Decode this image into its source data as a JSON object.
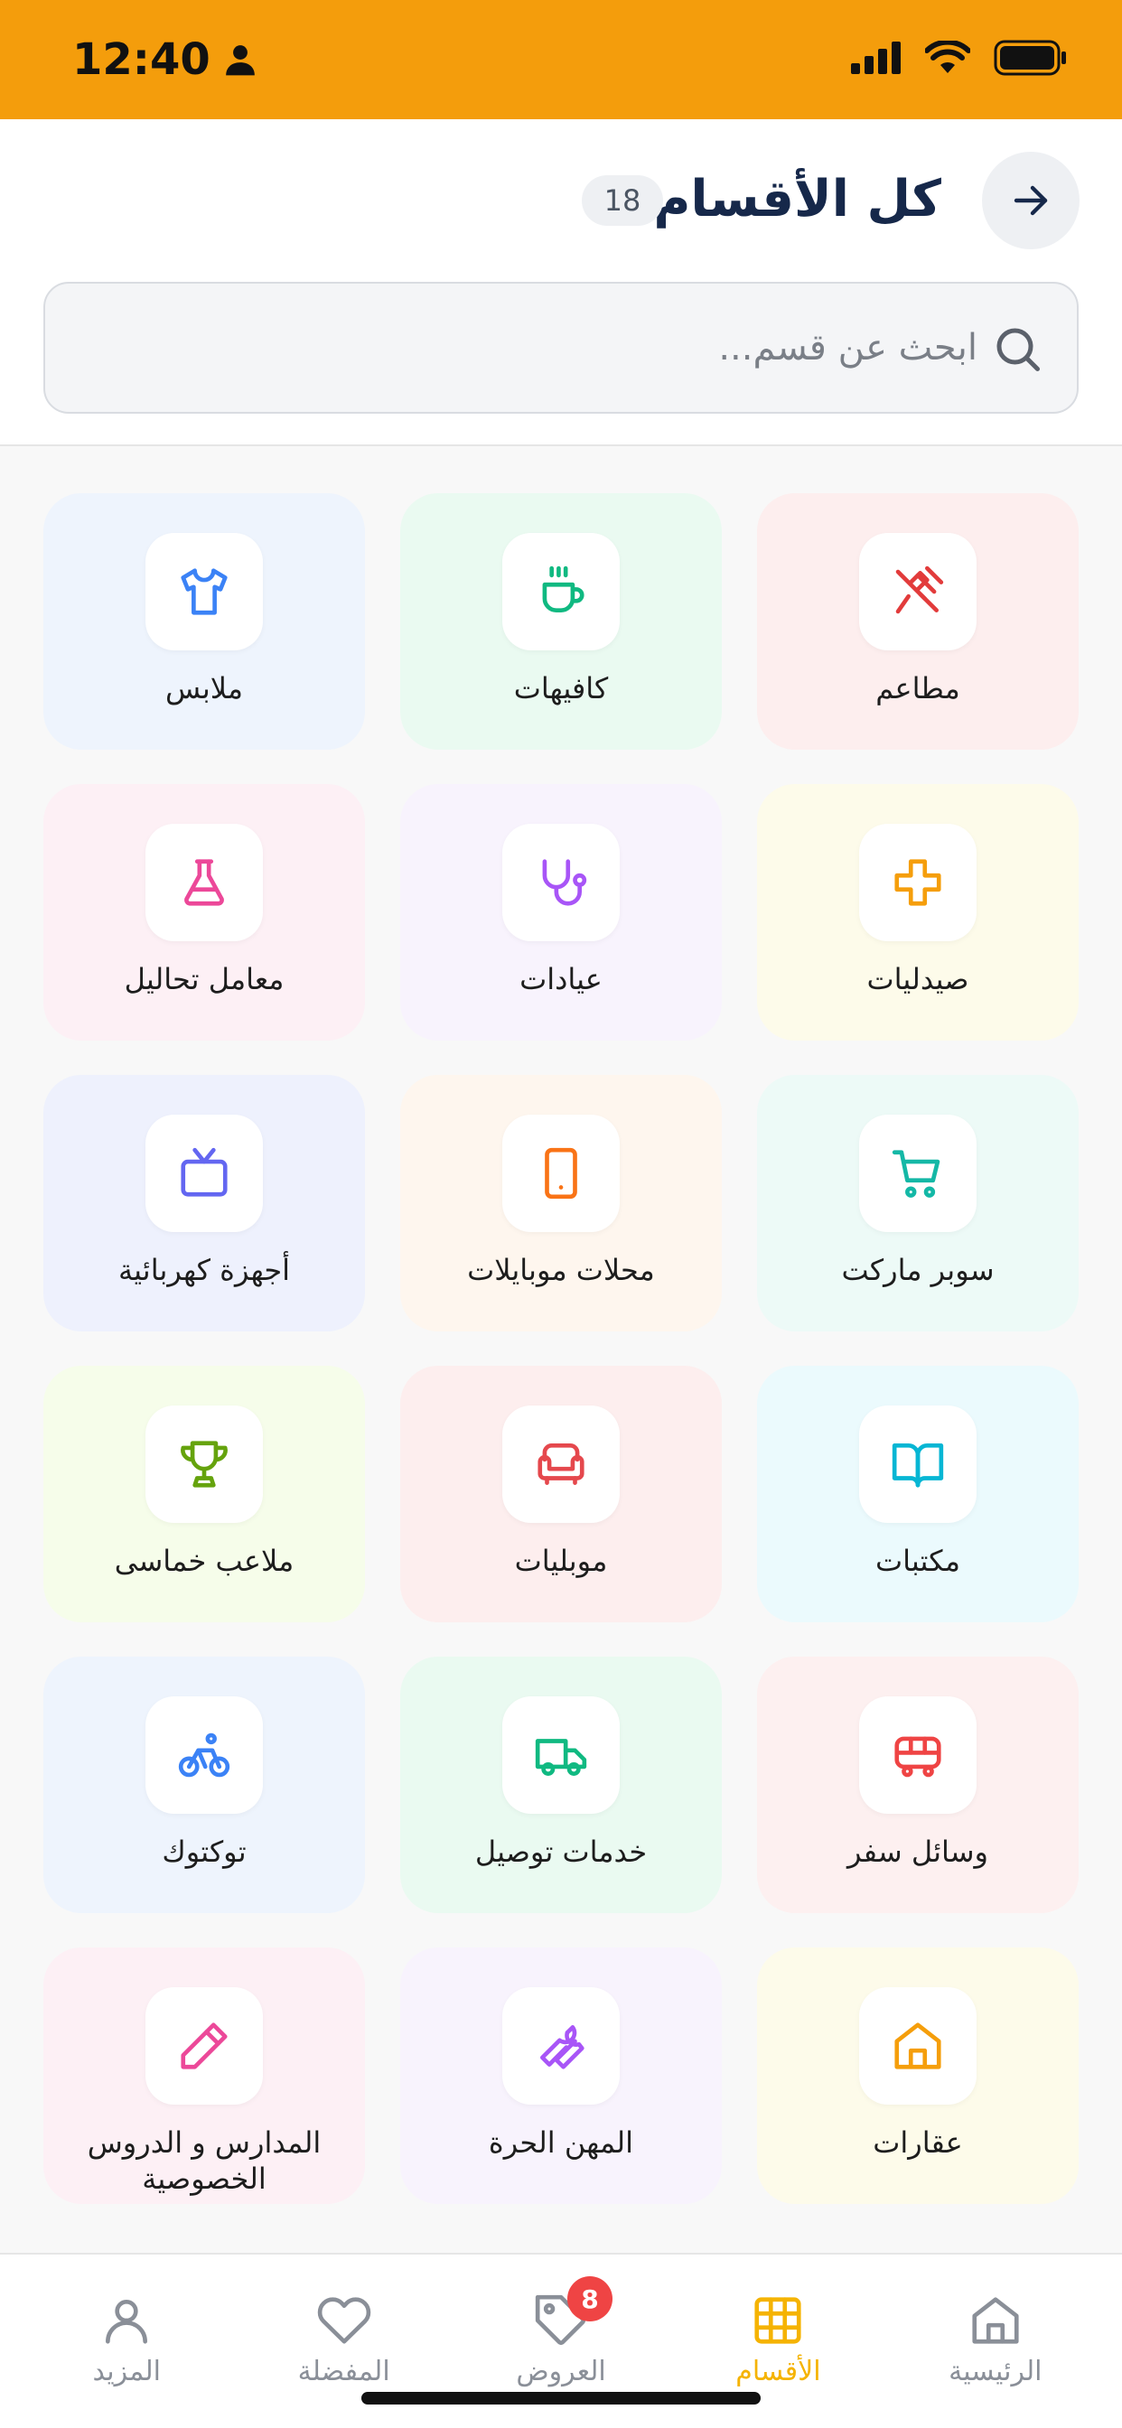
{
  "status_bar": {
    "time": "12:40"
  },
  "header": {
    "title": "كل الأقسام",
    "count": "18"
  },
  "search": {
    "placeholder": "ابحث عن قسم..."
  },
  "categories": [
    {
      "label": "مطاعم",
      "icon": "utensils-crossed-icon",
      "color": "#e23b3b",
      "bg": "#fdeeee"
    },
    {
      "label": "كافيهات",
      "icon": "coffee-cup-icon",
      "color": "#10b981",
      "bg": "#eafaf1"
    },
    {
      "label": "ملابس",
      "icon": "shirt-icon",
      "color": "#3b82f6",
      "bg": "#eef4fd"
    },
    {
      "label": "صيدليات",
      "icon": "medical-cross-icon",
      "color": "#f59e0b",
      "bg": "#fdfbea"
    },
    {
      "label": "عيادات",
      "icon": "stethoscope-icon",
      "color": "#a855f7",
      "bg": "#f8f3fd"
    },
    {
      "label": "معامل تحاليل",
      "icon": "flask-icon",
      "color": "#ec4899",
      "bg": "#fdf0f5"
    },
    {
      "label": "سوبر ماركت",
      "icon": "shopping-cart-icon",
      "color": "#14b8a6",
      "bg": "#edfaf7"
    },
    {
      "label": "محلات موبايلات",
      "icon": "smartphone-icon",
      "color": "#f97316",
      "bg": "#fef6ee"
    },
    {
      "label": "أجهزة كهربائية",
      "icon": "tv-icon",
      "color": "#6366f1",
      "bg": "#eef1fd"
    },
    {
      "label": "مكتبات",
      "icon": "book-open-icon",
      "color": "#06b6d4",
      "bg": "#ebfafd"
    },
    {
      "label": "موبليات",
      "icon": "sofa-icon",
      "color": "#e5484d",
      "bg": "#fdeeee"
    },
    {
      "label": "ملاعب خماسى",
      "icon": "trophy-icon",
      "color": "#65a30d",
      "bg": "#f6fdea"
    },
    {
      "label": "وسائل سفر",
      "icon": "bus-icon",
      "color": "#ef4444",
      "bg": "#fdf0f0"
    },
    {
      "label": "خدمات توصيل",
      "icon": "truck-icon",
      "color": "#10b981",
      "bg": "#eafaf1"
    },
    {
      "label": "توكتوك",
      "icon": "bicycle-icon",
      "color": "#3b82f6",
      "bg": "#eef4fd"
    },
    {
      "label": "عقارات",
      "icon": "house-icon",
      "color": "#f59e0b",
      "bg": "#fdfbea"
    },
    {
      "label": "المهن الحرة",
      "icon": "wrench-icon",
      "color": "#a855f7",
      "bg": "#f8f3fd"
    },
    {
      "label": "المدارس و الدروس الخصوصية",
      "icon": "pencil-icon",
      "color": "#ec4899",
      "bg": "#fdf0f5"
    }
  ],
  "bottom_nav": [
    {
      "label": "الرئيسية",
      "icon": "home-icon",
      "active": false
    },
    {
      "label": "الأقسام",
      "icon": "grid-icon",
      "active": true
    },
    {
      "label": "العروض",
      "icon": "tag-icon",
      "active": false,
      "badge": "8"
    },
    {
      "label": "المفضلة",
      "icon": "heart-icon",
      "active": false
    },
    {
      "label": "المزيد",
      "icon": "user-icon",
      "active": false
    }
  ],
  "colors": {
    "accent": "#f49d0c",
    "active_nav": "#f5b301",
    "title": "#16284a",
    "badge": "#ef4444"
  }
}
